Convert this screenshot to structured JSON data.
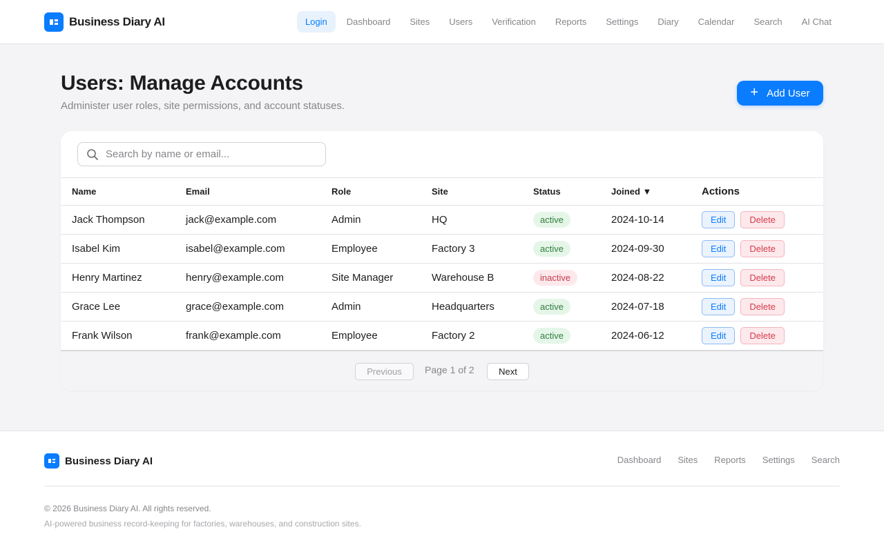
{
  "brand": {
    "name": "Business Diary AI",
    "accent_color": "#0a7cff"
  },
  "nav": {
    "items": [
      "Login",
      "Dashboard",
      "Sites",
      "Users",
      "Verification",
      "Reports",
      "Settings",
      "Diary",
      "Calendar",
      "Search",
      "AI Chat"
    ],
    "active": "Login"
  },
  "page": {
    "title": "Users: Manage Accounts",
    "subtitle": "Administer user roles, site permissions, and account statuses.",
    "add_button": {
      "icon": "plus-icon",
      "label": "Add User"
    }
  },
  "search": {
    "icon": "search-icon",
    "value": "",
    "placeholder": "Search by name or email..."
  },
  "table": {
    "headers": {
      "name": "Name",
      "email": "Email",
      "role": "Role",
      "site": "Site",
      "status": "Status",
      "joined": "Joined ▼",
      "actions": "Actions"
    },
    "sort": {
      "column": "Joined",
      "direction": "descending"
    },
    "rows": [
      {
        "name": "Jack Thompson",
        "email": "jack@example.com",
        "role": "Admin",
        "site": "HQ",
        "status": "active",
        "joined": "2024-10-14",
        "edit": "Edit",
        "delete": "Delete"
      },
      {
        "name": "Isabel Kim",
        "email": "isabel@example.com",
        "role": "Employee",
        "site": "Factory 3",
        "status": "active",
        "joined": "2024-09-30",
        "edit": "Edit",
        "delete": "Delete"
      },
      {
        "name": "Henry Martinez",
        "email": "henry@example.com",
        "role": "Site Manager",
        "site": "Warehouse B",
        "status": "inactive",
        "joined": "2024-08-22",
        "edit": "Edit",
        "delete": "Delete"
      },
      {
        "name": "Grace Lee",
        "email": "grace@example.com",
        "role": "Admin",
        "site": "Headquarters",
        "status": "active",
        "joined": "2024-07-18",
        "edit": "Edit",
        "delete": "Delete"
      },
      {
        "name": "Frank Wilson",
        "email": "frank@example.com",
        "role": "Employee",
        "site": "Factory 2",
        "status": "active",
        "joined": "2024-06-12",
        "edit": "Edit",
        "delete": "Delete"
      }
    ]
  },
  "pagination": {
    "previous": "Previous",
    "info": "Page 1 of 2",
    "next": "Next"
  },
  "status_colors": {
    "active": "#2f7d3b",
    "inactive": "#c63a4a"
  },
  "footer": {
    "brand": "Business Diary AI",
    "links": [
      "Dashboard",
      "Sites",
      "Reports",
      "Settings",
      "Search"
    ],
    "copyright": "© 2026 Business Diary AI. All rights reserved.",
    "tagline": "AI-powered business record-keeping for factories, warehouses, and construction sites."
  }
}
